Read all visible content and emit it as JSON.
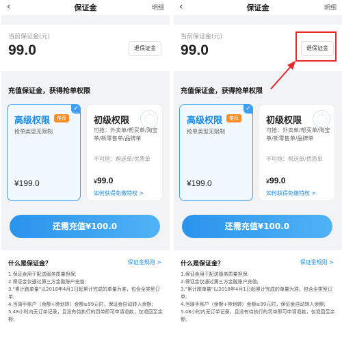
{
  "header": {
    "back_icon": "‹",
    "title": "保证金",
    "detail": "明细"
  },
  "balance": {
    "label": "当前保证金(元)",
    "value": "99.0",
    "refund_button": "退保证金"
  },
  "section_title": "充值保证金，获得抢单权限",
  "tiers": {
    "senior": {
      "name": "高级权限",
      "badge": "推荐",
      "check_icon": "✓",
      "desc": "抢单类型无限制",
      "price": "¥199.0"
    },
    "junior": {
      "name": "初级权限",
      "can_grab": "可抢：外卖单/帮买单/淘宝单/新零售单/品牌单",
      "cannot_grab": "不可抢：帮送单/优质单",
      "price_symbol": "¥",
      "price_value": "99.0",
      "exempt_link": "如何获得免缴特权 >"
    }
  },
  "pay_button": "还需充值¥100.0",
  "faq": {
    "title": "什么是保证金？",
    "rules_link": "保证金规则 >",
    "rules": [
      "1.保证金用于配送服务质量担保;",
      "2.保证金仅通过第三方金融账户充值;",
      "3.\"累计跑单量\"以2018年4月1日起累计完成的单量为准，包含全类型订单;",
      "4.当骑手账户（余额+待划转）金额≥99元时，保证金自动转入余额;",
      "5.48小时内无订单记录，且没有待执行的罚单即可申请退款，仅退回至余额;"
    ]
  },
  "colors": {
    "accent": "#1a8ae6",
    "highlight": "#e8262a",
    "badge": "#ff8a1f"
  }
}
